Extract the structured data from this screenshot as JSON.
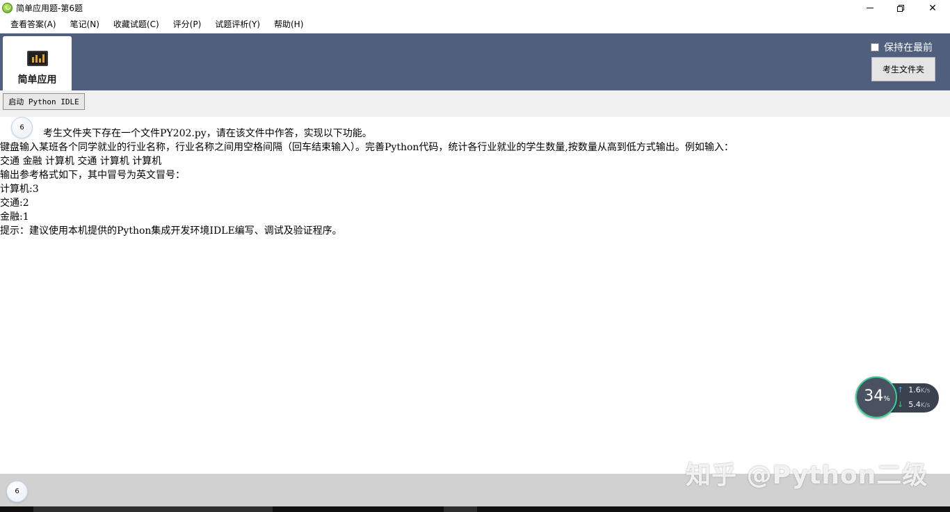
{
  "window": {
    "title": "简单应用题-第6题",
    "minimize_glyph": "",
    "close_glyph": "✕"
  },
  "menu": {
    "items": [
      "查看答案(A)",
      "笔记(N)",
      "收藏试题(C)",
      "评分(P)",
      "试题评析(Y)",
      "帮助(H)"
    ]
  },
  "header": {
    "module_label": "简单应用",
    "keep_on_top_label": "保持在最前",
    "keep_on_top_checked": false,
    "exam_folder_button": "考生文件夹"
  },
  "toolbar": {
    "launch_idle_button": "启动 Python IDLE"
  },
  "question": {
    "number": "6",
    "lines": [
      "考生文件夹下存在一个文件PY202.py，请在该文件中作答，实现以下功能。",
      "键盘输入某班各个同学就业的行业名称，行业名称之间用空格间隔（回车结束输入）。完善Python代码，统计各行业就业的学生数量,按数量从高到低方式输出。例如输入：",
      "交通 金融 计算机 交通 计算机 计算机",
      "输出参考格式如下，其中冒号为英文冒号：",
      "计算机:3",
      "交通:2",
      "金融:1",
      "提示：建议使用本机提供的Python集成开发环境IDLE编写、调试及验证程序。"
    ]
  },
  "footer": {
    "question_number": "6",
    "watermark": "知乎 @Python二级"
  },
  "net_monitor": {
    "percent": "34",
    "percent_unit": "%",
    "upload_value": "1.6",
    "upload_unit": "K/s",
    "download_value": "5.4",
    "download_unit": "K/s",
    "accent_color": "#3ccf9a"
  },
  "icons": {
    "app": "app-logo-icon",
    "module": "chart-monitor-icon",
    "up_arrow": "↑",
    "down_arrow": "↓"
  }
}
